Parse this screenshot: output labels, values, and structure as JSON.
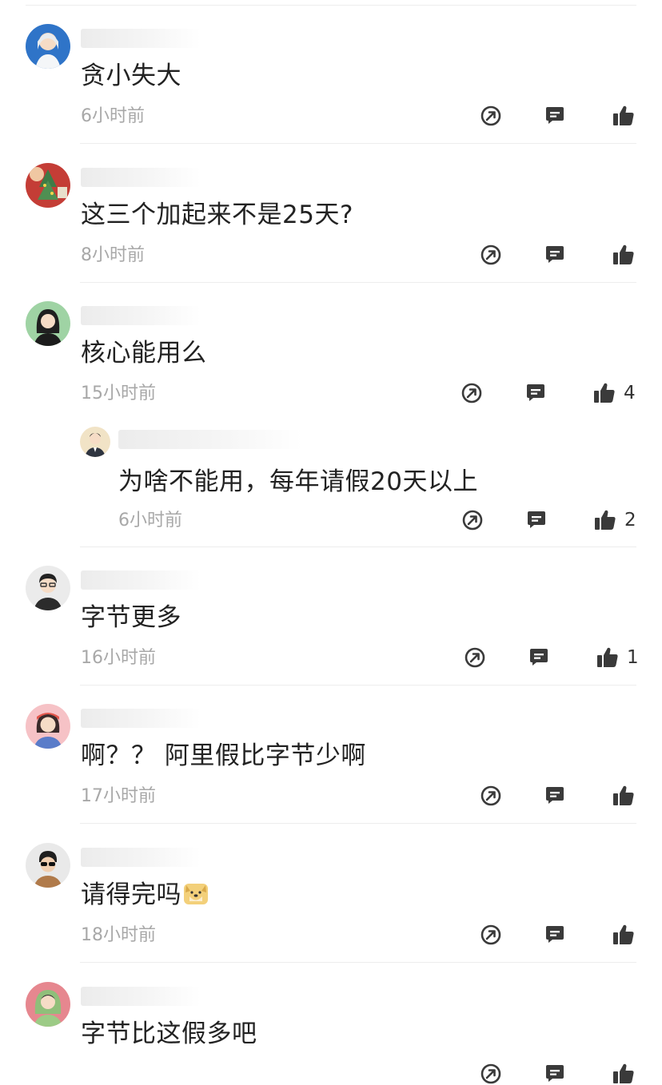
{
  "comments": [
    {
      "text": "贪小失大",
      "time": "6小时前",
      "likes": "",
      "avatar": "girl-white-hair-blue-bg"
    },
    {
      "text": "这三个加起来不是25天?",
      "time": "8小时前",
      "likes": "",
      "avatar": "christmas-tree-photo"
    },
    {
      "text": "核心能用么",
      "time": "15小时前",
      "likes": "4",
      "avatar": "woman-black-hair-green-bg"
    },
    {
      "text": "为啥不能用，每年请假20天以上",
      "time": "6小时前",
      "likes": "2",
      "avatar": "man-suit-cream-bg",
      "is_reply": true
    },
    {
      "text": "字节更多",
      "time": "16小时前",
      "likes": "1",
      "avatar": "man-glasses-gray-bg"
    },
    {
      "text": "啊？？ 阿里假比字节少啊",
      "time": "17小时前",
      "likes": "",
      "avatar": "girl-red-hat-pink-bg"
    },
    {
      "text": "请得完吗",
      "time": "18小时前",
      "likes": "",
      "avatar": "man-sunglasses-gray-bg",
      "emoji": "doge-emoji"
    },
    {
      "text": "字节比这假多吧",
      "time": "",
      "likes": "",
      "avatar": "girl-green-hood-pink-bg"
    }
  ],
  "icons": {
    "share": "share-icon",
    "reply": "reply-icon",
    "like": "thumbs-up-icon"
  },
  "colors": {
    "text": "#222222",
    "meta": "#a8a8a8",
    "icon": "#3a3a3a",
    "divider": "#ededed"
  }
}
